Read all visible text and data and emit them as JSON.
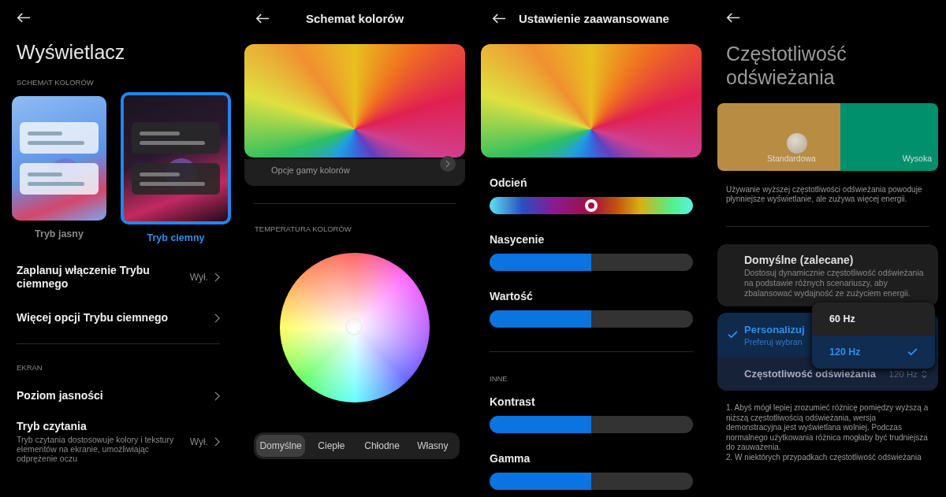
{
  "display_screen": {
    "title": "Wyświetlacz",
    "scheme_section": "SCHEMAT KOLORÓW",
    "themes": [
      {
        "label": "Tryb jasny",
        "kind": "light",
        "selected": false
      },
      {
        "label": "Tryb ciemny",
        "kind": "dark",
        "selected": true
      }
    ],
    "rows": [
      {
        "title": "Zaplanuj włączenie Trybu ciemnego",
        "value": "Wył."
      },
      {
        "title": "Więcej opcji Trybu ciemnego"
      }
    ],
    "screen_section": "EKRAN",
    "rows2": [
      {
        "title": "Poziom jasności"
      },
      {
        "title": "Tryb czytania",
        "subtitle": "Tryb czytania dostosowuje kolory i tekstury elementów na ekranie, umożliwiając odprężenie oczu",
        "value": "Wył."
      }
    ]
  },
  "color_scheme_screen": {
    "title": "Schemat kolorów",
    "card_subtitle": "Opcje gamy kolorów",
    "temperature_section": "TEMPERATURA KOLORÓW",
    "presets": [
      {
        "label": "Domyślne",
        "selected": true
      },
      {
        "label": "Ciepłe",
        "selected": false
      },
      {
        "label": "Chłodne",
        "selected": false
      },
      {
        "label": "Własny",
        "selected": false
      }
    ]
  },
  "advanced_screen": {
    "title": "Ustawienie zaawansowane",
    "sliders": [
      {
        "label": "Odcień",
        "kind": "hue",
        "level": 0.5
      },
      {
        "label": "Nasycenie",
        "kind": "bar",
        "level": 0.5
      },
      {
        "label": "Wartość",
        "kind": "bar",
        "level": 0.5
      }
    ],
    "other_section": "INNE",
    "sliders2": [
      {
        "label": "Kontrast",
        "kind": "bar",
        "level": 0.5
      },
      {
        "label": "Gamma",
        "kind": "bar",
        "level": 0.5
      }
    ]
  },
  "refresh_rate_screen": {
    "title": "Częstotliwość odświeżania",
    "preview": {
      "standard_label": "Standardowa",
      "high_label": "Wysoka"
    },
    "description": "Używanie wyższej częstotliwości odświeżania powoduje płynniejsze wyświetlanie, ale zużywa więcej energii.",
    "options": [
      {
        "title": "Domyślne (zalecane)",
        "subtitle": "Dostosuj dynamicznie częstotliwość odświeżania na podstawie różnych scenariuszy, aby zbalansować wydajność ze zużyciem energii.",
        "selected": false
      },
      {
        "title": "Personalizuj",
        "subtitle": "Preferuj wybran",
        "selected": true
      }
    ],
    "rate_row": {
      "label": "Częstotliwość odświeżania",
      "value": "120 Hz"
    },
    "dropdown": [
      {
        "label": "60 Hz",
        "selected": false
      },
      {
        "label": "120 Hz",
        "selected": true
      }
    ],
    "notes": [
      "1. Abyś mógł lepiej zrozumieć różnicę pomiędzy wyższą a niższą częstotliwością odświeżania, wersja demonstracyjna jest wyświetlana wolniej. Podczas normalnego użytkowania różnica mogłaby być trudniejsza do zauważenia.",
      "2. W niektórych przypadkach częstotliwość odświeżania"
    ]
  }
}
